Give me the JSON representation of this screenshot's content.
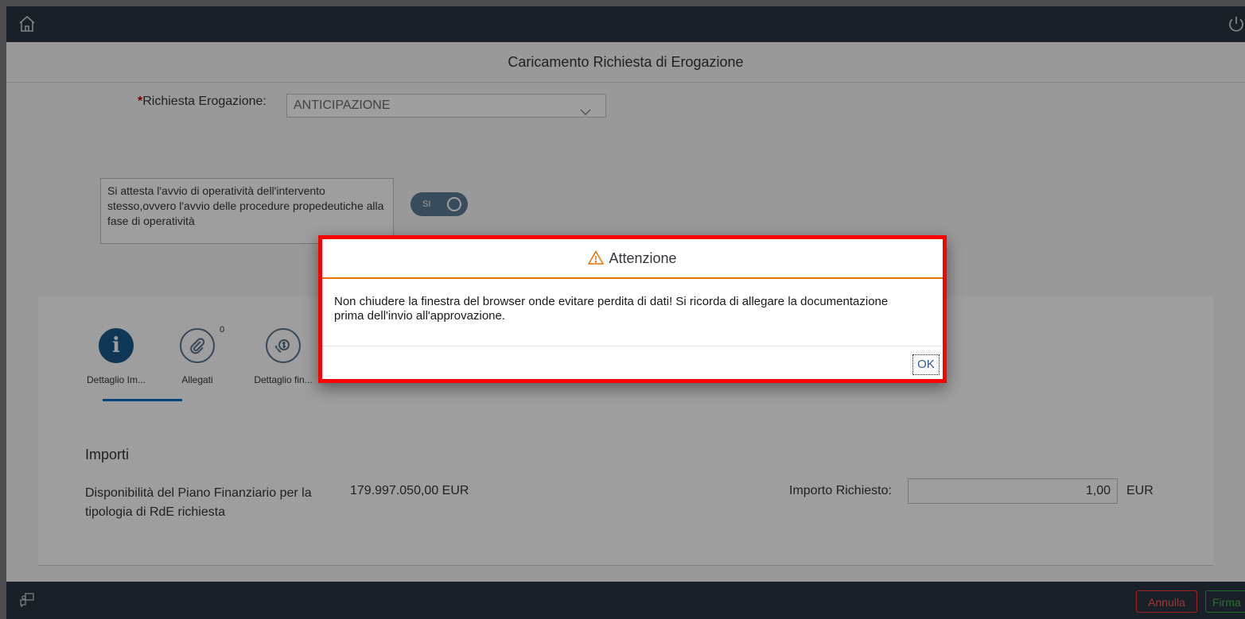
{
  "page": {
    "title": "Caricamento Richiesta di Erogazione"
  },
  "form": {
    "richiesta_label": "Richiesta Erogazione:",
    "richiesta_required": "*",
    "richiesta_value": "ANTICIPAZIONE",
    "attest_text": "Si attesta l'avvio di operatività dell'intervento stesso,ovvero l'avvio delle procedure propedeutiche alla fase di operatività",
    "toggle_label": "SI",
    "toggle_on": true
  },
  "tabs": [
    {
      "label": "Dettaglio Im...",
      "icon": "info-icon",
      "selected": true
    },
    {
      "label": "Allegati",
      "icon": "paperclip-icon",
      "count": "0"
    },
    {
      "label": "Dettaglio fin...",
      "icon": "money-icon"
    }
  ],
  "importi": {
    "section_title": "Importi",
    "avail_label": "Disponibilità del Piano Finanziario per la tipologia di RdE richiesta",
    "avail_value": "179.997.050,00 EUR",
    "importo_label": "Importo Richiesto:",
    "importo_value": "1,00",
    "importo_unit": "EUR"
  },
  "footer": {
    "annulla": "Annulla",
    "firma": "Firma"
  },
  "dialog": {
    "title": "Attenzione",
    "message": "Non chiudere la finestra del browser onde evitare perdita di dati! Si ricorda di allegare la documentazione prima dell'invio all'approvazione.",
    "ok": "OK"
  },
  "colors": {
    "shell": "#2a3440",
    "accent": "#0a6ed1",
    "warning": "#e9730c",
    "highlight": "#ff0000"
  }
}
